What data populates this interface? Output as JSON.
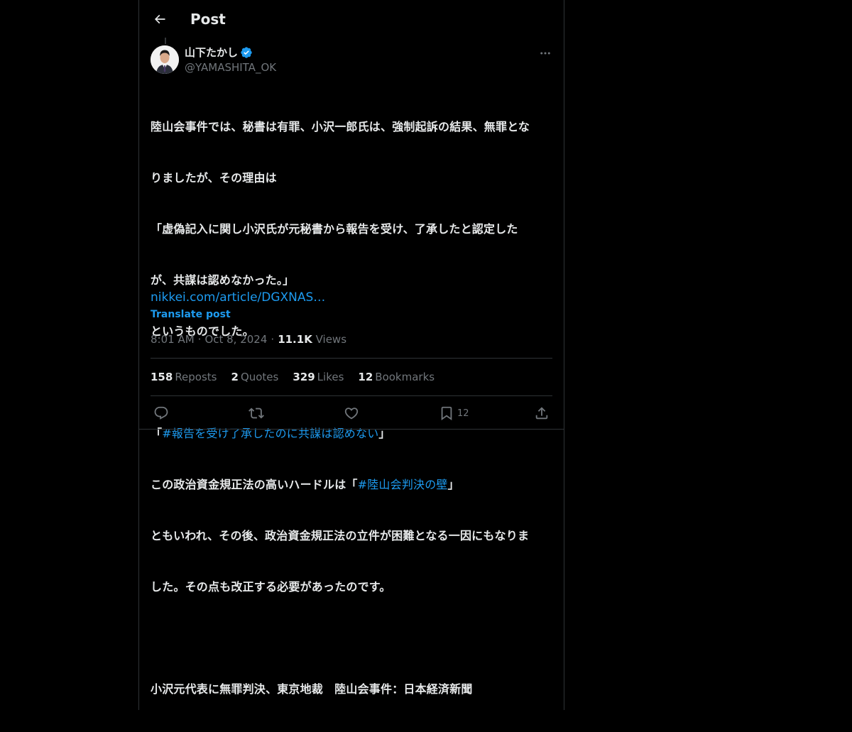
{
  "header": {
    "title": "Post"
  },
  "author": {
    "name": "山下たかし",
    "handle": "@YAMASHITA_OK"
  },
  "post": {
    "lines": [
      "陸山会事件では、秘書は有罪、小沢一郎氏は、強制起訴の結果、無罪とな",
      "りましたが、その理由は",
      "「虚偽記入に関し小沢氏が元秘書から報告を受け、了承したと認定した",
      "が、共謀は認めなかった。」",
      "というものでした。",
      "",
      "",
      "",
      "ともいわれ、その後、政治資金規正法の立件が困難となる一因にもなりま",
      "した。その点も改正する必要があったのです。",
      "",
      "小沢元代表に無罪判決、東京地裁　陸山会事件：日本経済新聞"
    ],
    "line6": {
      "open": "「",
      "hashtag": "#報告を受け了承したのに共謀は認めない",
      "close": "」"
    },
    "line7": {
      "prefix": "この政治資金規正法の高いハードルは「",
      "hashtag": "#陸山会判決の壁",
      "close": "」"
    },
    "link": "nikkei.com/article/DGXNAS…",
    "translate": "Translate post"
  },
  "meta": {
    "time": "8:01 AM",
    "date": "Oct 8, 2024",
    "views_count": "11.1K",
    "views_label": "Views",
    "separator": "·"
  },
  "stats": [
    {
      "num": "158",
      "label": "Reposts"
    },
    {
      "num": "2",
      "label": "Quotes"
    },
    {
      "num": "329",
      "label": "Likes"
    },
    {
      "num": "12",
      "label": "Bookmarks"
    }
  ],
  "actions": {
    "bookmark_count": "12"
  },
  "icons": {
    "back": "back-arrow-icon",
    "verified": "verified-badge-icon",
    "more": "more-options-icon",
    "reply": "reply-icon",
    "repost": "repost-icon",
    "like": "like-icon",
    "bookmark": "bookmark-icon",
    "share": "share-icon"
  },
  "colors": {
    "background": "#000000",
    "text": "#e7e9ea",
    "secondary": "#71767b",
    "accent": "#1d9bf0",
    "border": "#2f3336"
  }
}
